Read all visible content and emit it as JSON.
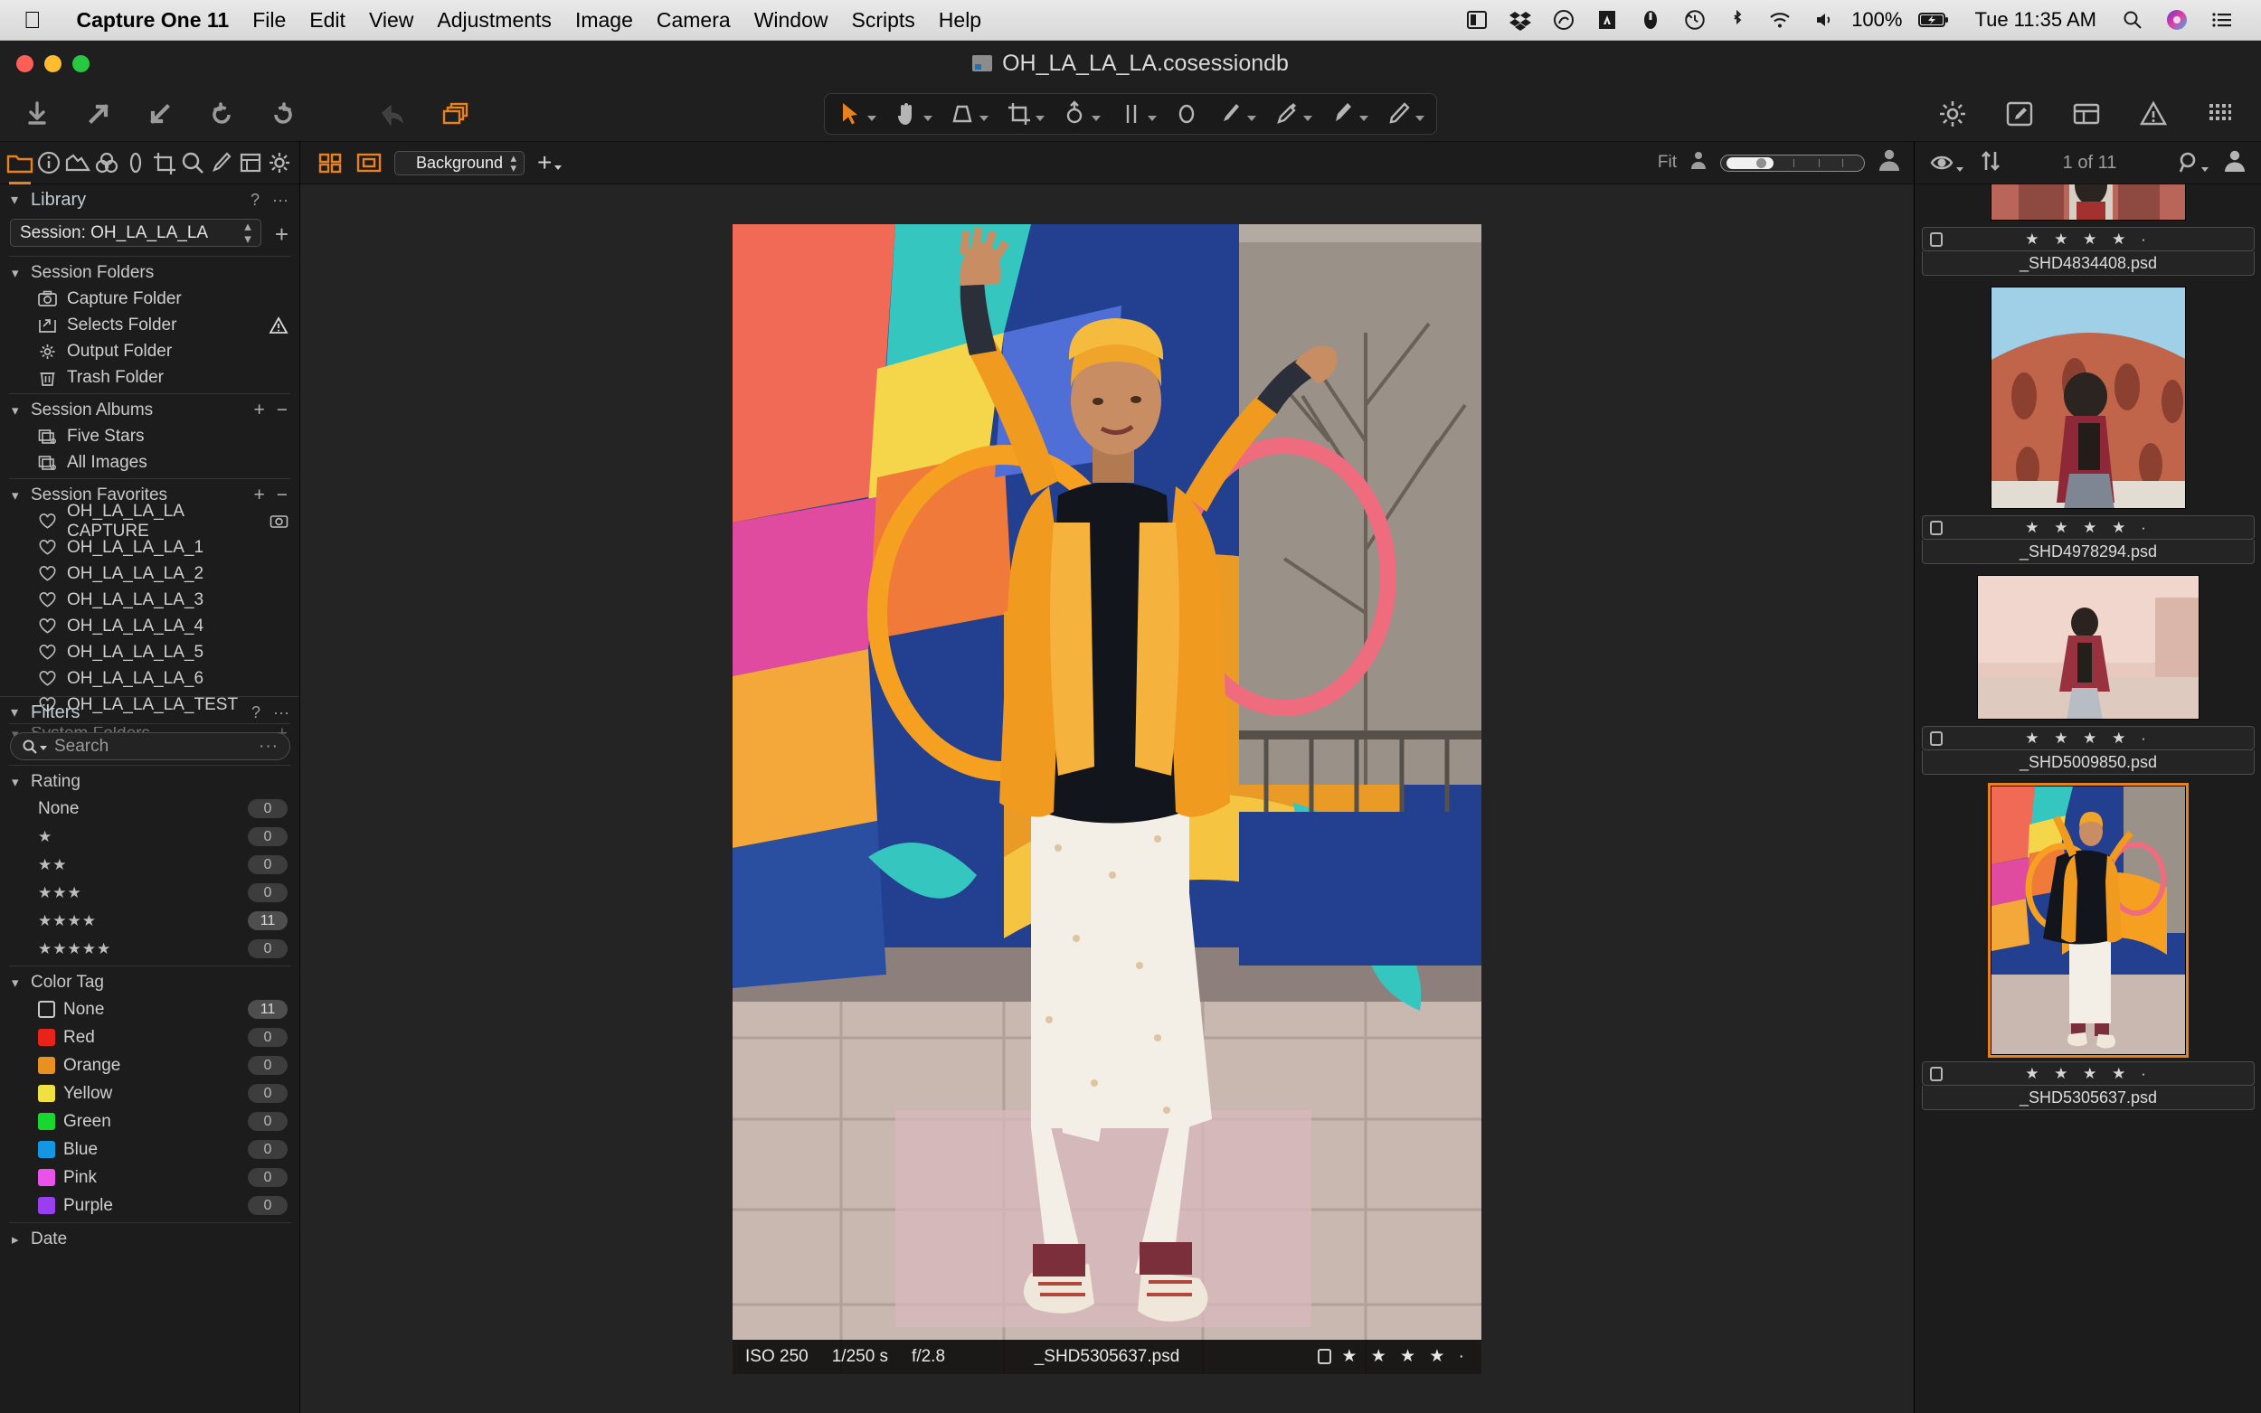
{
  "menubar": {
    "apple_icon": "apple-icon",
    "items": [
      "Capture One 11",
      "File",
      "Edit",
      "View",
      "Adjustments",
      "Image",
      "Camera",
      "Window",
      "Scripts",
      "Help"
    ],
    "status_icons": [
      "display-icon",
      "dropbox-icon",
      "creative-cloud-icon",
      "adobe-icon",
      "app-icon",
      "time-machine-icon",
      "bluetooth-icon",
      "wifi-icon",
      "volume-icon"
    ],
    "battery_percent": "100%",
    "battery_icon": "battery-charging-icon",
    "clock": "Tue 11:35 AM",
    "search_icon": "spotlight-search-icon",
    "siri_icon": "siri-icon",
    "notification_icon": "notification-center-icon"
  },
  "window": {
    "title": "OH_LA_LA_LA.cosessiondb",
    "title_icon": "session-document-icon",
    "close_color": "#ff5f57",
    "minimize_color": "#febc2e",
    "zoom_color": "#28c840"
  },
  "toolbar": {
    "left_tools": [
      {
        "name": "import-images-icon",
        "label": "Import Images"
      },
      {
        "name": "export-icon",
        "label": "Export"
      },
      {
        "name": "import-arrow-icon",
        "label": "Import"
      },
      {
        "name": "rotate-left-icon",
        "label": "Rotate Left"
      },
      {
        "name": "rotate-right-icon",
        "label": "Rotate Right"
      },
      {
        "name": "undo-icon",
        "label": "Undo"
      },
      {
        "name": "copy-apply-adjustments-icon",
        "label": "Copy and Apply Adjustments"
      }
    ],
    "cursor_tools": [
      {
        "name": "select-pointer-icon",
        "label": "Pan / Select",
        "active": true
      },
      {
        "name": "pan-hand-icon",
        "label": "Pan"
      },
      {
        "name": "keystone-icon",
        "label": "Keystone"
      },
      {
        "name": "crop-icon",
        "label": "Crop"
      },
      {
        "name": "rotate-tool-icon",
        "label": "Rotate"
      },
      {
        "name": "guides-icon",
        "label": "Guides"
      },
      {
        "name": "spot-removal-icon",
        "label": "Spot Removal"
      },
      {
        "name": "draw-mask-brush-icon",
        "label": "Draw Mask"
      },
      {
        "name": "color-picker-icon",
        "label": "Pick Color Correction"
      },
      {
        "name": "erase-mask-icon",
        "label": "Erase Mask"
      },
      {
        "name": "gradient-mask-icon",
        "label": "Linear Gradient Mask"
      }
    ],
    "right_tools": [
      {
        "name": "preferences-gear-icon",
        "label": "Preferences"
      },
      {
        "name": "edit-with-icon",
        "label": "Edit With"
      },
      {
        "name": "batch-icon",
        "label": "Batch"
      },
      {
        "name": "warning-icon",
        "label": "Warnings"
      },
      {
        "name": "grid-view-icon",
        "label": "Viewer Grid"
      }
    ]
  },
  "left_panel": {
    "tool_tabs": [
      {
        "name": "library-tab",
        "label": "Library",
        "active": true
      },
      {
        "name": "capture-tab",
        "label": "Capture"
      },
      {
        "name": "lens-tab",
        "label": "Lens"
      },
      {
        "name": "color-tab",
        "label": "Color"
      },
      {
        "name": "exposure-tab",
        "label": "Exposure"
      },
      {
        "name": "details-tab",
        "label": "Details"
      },
      {
        "name": "adjustments-tab",
        "label": "Adjustments"
      },
      {
        "name": "metadata-tab",
        "label": "Metadata"
      },
      {
        "name": "output-tab",
        "label": "Output"
      }
    ],
    "library": {
      "title": "Library",
      "help_glyph": "?",
      "menu_glyph": "···",
      "session_value": "Session: OH_LA_LA_LA",
      "add_glyph": "+",
      "session_folders": {
        "title": "Session Folders",
        "items": [
          {
            "label": "Capture Folder",
            "icon": "camera-folder-icon",
            "badge": ""
          },
          {
            "label": "Selects Folder",
            "icon": "selects-folder-icon",
            "badge": "warning-triangle-icon"
          },
          {
            "label": "Output Folder",
            "icon": "gear-folder-icon",
            "badge": ""
          },
          {
            "label": "Trash Folder",
            "icon": "trash-folder-icon",
            "badge": ""
          }
        ]
      },
      "session_albums": {
        "title": "Session Albums",
        "add_glyph": "+",
        "remove_glyph": "−",
        "items": [
          {
            "label": "Five Stars",
            "icon": "album-icon"
          },
          {
            "label": "All Images",
            "icon": "album-icon"
          }
        ]
      },
      "session_favorites": {
        "title": "Session Favorites",
        "add_glyph": "+",
        "remove_glyph": "−",
        "items": [
          {
            "label": "OH_LA_LA_LA CAPTURE",
            "icon": "heart-icon",
            "badge": "camera-badge-icon"
          },
          {
            "label": "OH_LA_LA_LA_1",
            "icon": "heart-icon",
            "badge": ""
          },
          {
            "label": "OH_LA_LA_LA_2",
            "icon": "heart-icon",
            "badge": ""
          },
          {
            "label": "OH_LA_LA_LA_3",
            "icon": "heart-icon",
            "badge": ""
          },
          {
            "label": "OH_LA_LA_LA_4",
            "icon": "heart-icon",
            "badge": ""
          },
          {
            "label": "OH_LA_LA_LA_5",
            "icon": "heart-icon",
            "badge": ""
          },
          {
            "label": "OH_LA_LA_LA_6",
            "icon": "heart-icon",
            "badge": ""
          },
          {
            "label": "OH_LA_LA_LA_TEST",
            "icon": "heart-icon",
            "badge": ""
          }
        ]
      },
      "system_folders": {
        "title": "System Folders"
      }
    },
    "filters": {
      "title": "Filters",
      "help_glyph": "?",
      "menu_glyph": "···",
      "search_placeholder": "Search",
      "search_value": "",
      "search_icon": "search-magnifier-icon",
      "rating": {
        "title": "Rating",
        "rows": [
          {
            "label": "None",
            "stars": 0,
            "count": "0"
          },
          {
            "label": "",
            "stars": 1,
            "count": "0"
          },
          {
            "label": "",
            "stars": 2,
            "count": "0"
          },
          {
            "label": "",
            "stars": 3,
            "count": "0"
          },
          {
            "label": "",
            "stars": 4,
            "count": "11"
          },
          {
            "label": "",
            "stars": 5,
            "count": "0"
          }
        ]
      },
      "color_tag": {
        "title": "Color Tag",
        "rows": [
          {
            "label": "None",
            "color": "none",
            "count": "11"
          },
          {
            "label": "Red",
            "color": "#e8231a",
            "count": "0"
          },
          {
            "label": "Orange",
            "color": "#e89020",
            "count": "0"
          },
          {
            "label": "Yellow",
            "color": "#f0e040",
            "count": "0"
          },
          {
            "label": "Green",
            "color": "#18d830",
            "count": "0"
          },
          {
            "label": "Blue",
            "color": "#1496e0",
            "count": "0"
          },
          {
            "label": "Pink",
            "color": "#ea52ea",
            "count": "0"
          },
          {
            "label": "Purple",
            "color": "#9a3ff0",
            "count": "0"
          }
        ]
      },
      "date": {
        "title": "Date"
      }
    }
  },
  "viewer_bar": {
    "grid_view_icon": "grid-view-icon",
    "single_view_icon": "single-view-icon",
    "background_value": "Background",
    "add_glyph": "+",
    "zoom_label": "Fit",
    "proof_icon": "proof-profile-icon",
    "left_person_icon": "small-person-icon",
    "right_person_icon": "large-person-icon"
  },
  "browser_bar": {
    "visibility_icon": "eye-visibility-icon",
    "sort_icon": "sort-arrows-icon",
    "counter": "1 of 11",
    "search_icon": "browser-search-icon",
    "thumb_size_icon": "thumbnail-size-icon"
  },
  "image_info": {
    "iso": "ISO 250",
    "shutter": "1/250 s",
    "aperture": "f/2.8",
    "filename": "_SHD5305637.psd",
    "color_tag": "none",
    "stars": "★ ★ ★ ★ ·"
  },
  "browser": {
    "thumbnails": [
      {
        "filename": "_SHD4834408.psd",
        "stars": "★ ★ ★ ★ ·",
        "selected": false,
        "kind": "archway-woman",
        "partial_top": true
      },
      {
        "filename": "_SHD4978294.psd",
        "stars": "★ ★ ★ ★ ·",
        "selected": false,
        "kind": "colosseum-woman"
      },
      {
        "filename": "_SHD5009850.psd",
        "stars": "★ ★ ★ ★ ·",
        "selected": false,
        "kind": "pink-wall-woman"
      },
      {
        "filename": "_SHD5305637.psd",
        "stars": "★ ★ ★ ★ ·",
        "selected": true,
        "kind": "mural-hoop-woman"
      }
    ]
  }
}
